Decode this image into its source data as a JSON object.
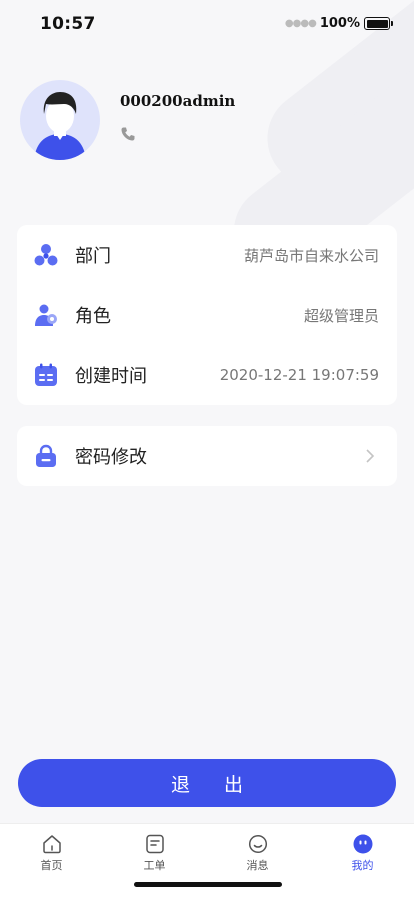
{
  "status_bar": {
    "time": "10:57",
    "battery": "100%"
  },
  "profile": {
    "username": "000200admin"
  },
  "info": {
    "department_label": "部门",
    "department_value": "葫芦岛市自来水公司",
    "role_label": "角色",
    "role_value": "超级管理员",
    "created_label": "创建时间",
    "created_value": "2020-12-21 19:07:59"
  },
  "password": {
    "label": "密码修改"
  },
  "logout_label": "退出",
  "tabs": [
    {
      "label": "首页",
      "icon": "home-icon"
    },
    {
      "label": "工单",
      "icon": "document-icon"
    },
    {
      "label": "消息",
      "icon": "message-icon"
    },
    {
      "label": "我的",
      "icon": "profile-icon",
      "active": true
    }
  ],
  "colors": {
    "accent": "#3e51ea",
    "avatar_bg": "#dfe3fb"
  }
}
